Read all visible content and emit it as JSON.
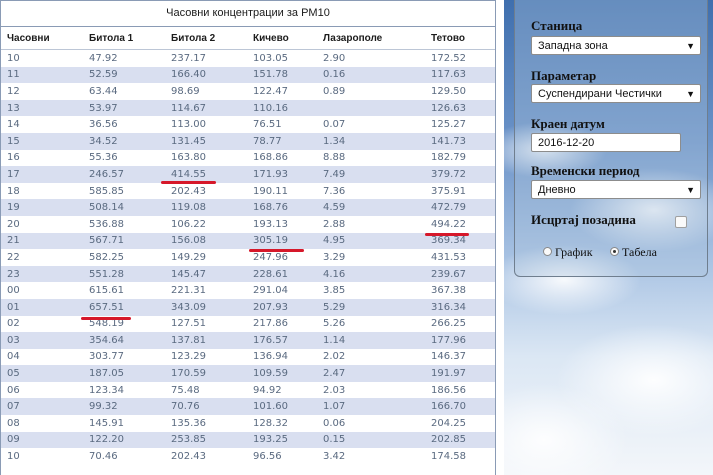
{
  "table": {
    "title": "Часовни концентрации за PM10",
    "columns": [
      "Часовни",
      "Битола 1",
      "Битола 2",
      "Кичево",
      "Лазарополе",
      "Тетово"
    ],
    "rows": [
      [
        "10",
        "47.92",
        "237.17",
        "103.05",
        "2.90",
        "172.52"
      ],
      [
        "11",
        "52.59",
        "166.40",
        "151.78",
        "0.16",
        "117.63"
      ],
      [
        "12",
        "63.44",
        "98.69",
        "122.47",
        "0.89",
        "129.50"
      ],
      [
        "13",
        "53.97",
        "114.67",
        "110.16",
        "",
        "126.63"
      ],
      [
        "14",
        "36.56",
        "113.00",
        "76.51",
        "0.07",
        "125.27"
      ],
      [
        "15",
        "34.52",
        "131.45",
        "78.77",
        "1.34",
        "141.73"
      ],
      [
        "16",
        "55.36",
        "163.80",
        "168.86",
        "8.88",
        "182.79"
      ],
      [
        "17",
        "246.57",
        "414.55",
        "171.93",
        "7.49",
        "379.72"
      ],
      [
        "18",
        "585.85",
        "202.43",
        "190.11",
        "7.36",
        "375.91"
      ],
      [
        "19",
        "508.14",
        "119.08",
        "168.76",
        "4.59",
        "472.79"
      ],
      [
        "20",
        "536.88",
        "106.22",
        "193.13",
        "2.88",
        "494.22"
      ],
      [
        "21",
        "567.71",
        "156.08",
        "305.19",
        "4.95",
        "369.34"
      ],
      [
        "22",
        "582.25",
        "149.29",
        "247.96",
        "3.29",
        "431.53"
      ],
      [
        "23",
        "551.28",
        "145.47",
        "228.61",
        "4.16",
        "239.67"
      ],
      [
        "00",
        "615.61",
        "221.31",
        "291.04",
        "3.85",
        "367.38"
      ],
      [
        "01",
        "657.51",
        "343.09",
        "207.93",
        "5.29",
        "316.34"
      ],
      [
        "02",
        "548.19",
        "127.51",
        "217.86",
        "5.26",
        "266.25"
      ],
      [
        "03",
        "354.64",
        "137.81",
        "176.57",
        "1.14",
        "177.96"
      ],
      [
        "04",
        "303.77",
        "123.29",
        "136.94",
        "2.02",
        "146.37"
      ],
      [
        "05",
        "187.05",
        "170.59",
        "109.59",
        "2.47",
        "191.97"
      ],
      [
        "06",
        "123.34",
        "75.48",
        "94.92",
        "2.03",
        "186.56"
      ],
      [
        "07",
        "99.32",
        "70.76",
        "101.60",
        "1.07",
        "166.70"
      ],
      [
        "08",
        "145.91",
        "135.36",
        "128.32",
        "0.06",
        "204.25"
      ],
      [
        "09",
        "122.20",
        "253.85",
        "193.25",
        "0.15",
        "202.85"
      ],
      [
        "10",
        "70.46",
        "202.43",
        "96.56",
        "3.42",
        "174.58"
      ]
    ]
  },
  "form": {
    "station_label": "Станица",
    "station_value": "Западна зона",
    "parameter_label": "Параметар",
    "parameter_value": "Суспендирани Честички",
    "end_date_label": "Краен датум",
    "end_date_value": "2016-12-20",
    "period_label": "Временски период",
    "period_value": "Дневно",
    "background_label": "Исцртај позадина",
    "radio_chart_label": "График",
    "radio_table_label": "Табела",
    "selected_view": "Табела"
  },
  "colors": {
    "highlight_underline": "#d6182a",
    "row_stripe": "#d9dff0"
  }
}
